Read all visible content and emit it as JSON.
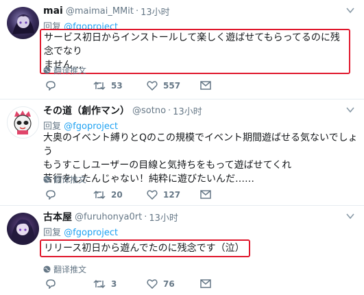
{
  "reply_prefix": "回复",
  "translate_label": "翻译推文",
  "accent_color": "#1da1f2",
  "highlight_color": "#e0162b",
  "tweets": [
    {
      "name": "mai",
      "handle": "@maimai_MMit",
      "time": "13小时",
      "reply_to": "@fgoproject",
      "text_line1": "サービス初日からインストールして楽しく遊ばせてもらってるのに残念でなり",
      "text_line2": "ません…",
      "retweets": "53",
      "likes": "557"
    },
    {
      "name": "その道（創作マン）",
      "handle": "@sotno",
      "time": "13小时",
      "reply_to": "@fgoproject",
      "text_line1": "大奥のイベント縛りとQのこの規模でイベント期間遊ばせる気ないでしょう",
      "text_line2": "もうすこしユーザーの目線と気持ちをもって遊ばせてくれ",
      "text_line3": "苦行をしたんじゃない！純粋に遊びたいんだ……",
      "retweets": "20",
      "likes": "127"
    },
    {
      "name": "古本屋",
      "handle": "@furuhonya0rt",
      "time": "13小时",
      "reply_to": "@fgoproject",
      "text_line1": "リリース初日から遊んでたのに残念です（泣）",
      "retweets": "3",
      "likes": "76"
    }
  ]
}
